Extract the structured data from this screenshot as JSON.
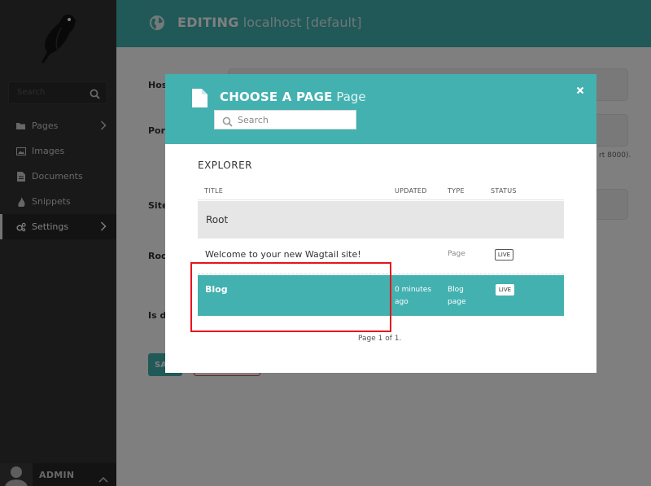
{
  "sidebar": {
    "search_placeholder": "Search",
    "items": [
      {
        "label": "Pages",
        "icon": "folder-icon",
        "has_submenu": true
      },
      {
        "label": "Images",
        "icon": "image-icon",
        "has_submenu": false
      },
      {
        "label": "Documents",
        "icon": "document-icon",
        "has_submenu": false
      },
      {
        "label": "Snippets",
        "icon": "snippet-icon",
        "has_submenu": false
      },
      {
        "label": "Settings",
        "icon": "cogs-icon",
        "has_submenu": true,
        "active": true
      }
    ],
    "user_label": "ADMIN"
  },
  "header": {
    "title_strong": "EDITING",
    "title_light": "localhost [default]",
    "icon": "globe-icon"
  },
  "form": {
    "labels": [
      "Hos",
      "Port",
      "Site",
      "Roo",
      "Is de"
    ],
    "port_help": "rt 8000).",
    "save_label": "SA"
  },
  "modal": {
    "title_strong": "CHOOSE A PAGE",
    "title_light": "Page",
    "close_symbol": "×",
    "search_placeholder": "Search",
    "explorer_heading": "EXPLORER",
    "columns": {
      "title": "TITLE",
      "updated": "UPDATED",
      "type": "TYPE",
      "status": "STATUS"
    },
    "rows": [
      {
        "title": "Root",
        "updated": "",
        "type": "",
        "status": ""
      },
      {
        "title": "Welcome to your new Wagtail site!",
        "updated": "",
        "type": "Page",
        "status": "LIVE"
      },
      {
        "title": "Blog",
        "updated": "0 minutes ago",
        "type": "Blog page",
        "status": "LIVE",
        "selected": true
      }
    ],
    "pagination": "Page 1 of 1."
  },
  "colors": {
    "teal": "#43b1b0",
    "sidebar": "#333333",
    "highlight": "#e8141b"
  }
}
